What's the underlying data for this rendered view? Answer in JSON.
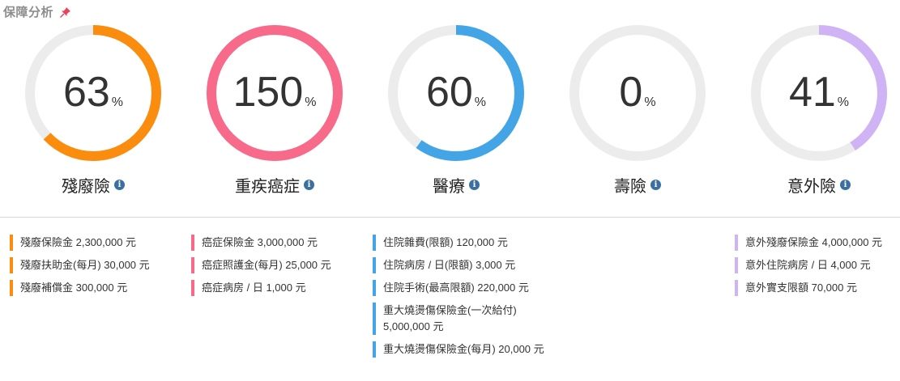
{
  "header": {
    "title": "保障分析",
    "pin_icon": "pin-icon"
  },
  "colors": {
    "track": "#ececec",
    "disability": "#fa8c0e",
    "critical": "#f76a8a",
    "medical": "#43a5e6",
    "life": "#ececec",
    "accident": "#d0b3f5"
  },
  "gauges": [
    {
      "value": 63,
      "value_text": "63",
      "unit": "%",
      "label": "殘廢險",
      "color": "#fa8c0e",
      "fill": 0.63
    },
    {
      "value": 150,
      "value_text": "150",
      "unit": "%",
      "label": "重疾癌症",
      "color": "#f76a8a",
      "fill": 1.0
    },
    {
      "value": 60,
      "value_text": "60",
      "unit": "%",
      "label": "醫療",
      "color": "#43a5e6",
      "fill": 0.6
    },
    {
      "value": 0,
      "value_text": "0",
      "unit": "%",
      "label": "壽險",
      "color": "#ececec",
      "fill": 0.0
    },
    {
      "value": 41,
      "value_text": "41",
      "unit": "%",
      "label": "意外險",
      "color": "#d0b3f5",
      "fill": 0.41
    }
  ],
  "details": {
    "disability": [
      "殘廢保險金 2,300,000 元",
      "殘廢扶助金(每月) 30,000 元",
      "殘廢補償金 300,000 元"
    ],
    "critical": [
      "癌症保險金 3,000,000 元",
      "癌症照護金(每月) 25,000 元",
      "癌症病房 / 日 1,000 元"
    ],
    "medical": [
      "住院雜費(限額) 120,000 元",
      "住院病房 / 日(限額) 3,000 元",
      "住院手術(最高限額) 220,000 元",
      "重大燒燙傷保險金(一次給付) 5,000,000 元",
      "重大燒燙傷保險金(每月) 20,000 元"
    ],
    "accident": [
      "意外殘廢保險金 4,000,000 元",
      "意外住院病房 / 日 4,000 元",
      "意外實支限額 70,000 元"
    ]
  }
}
